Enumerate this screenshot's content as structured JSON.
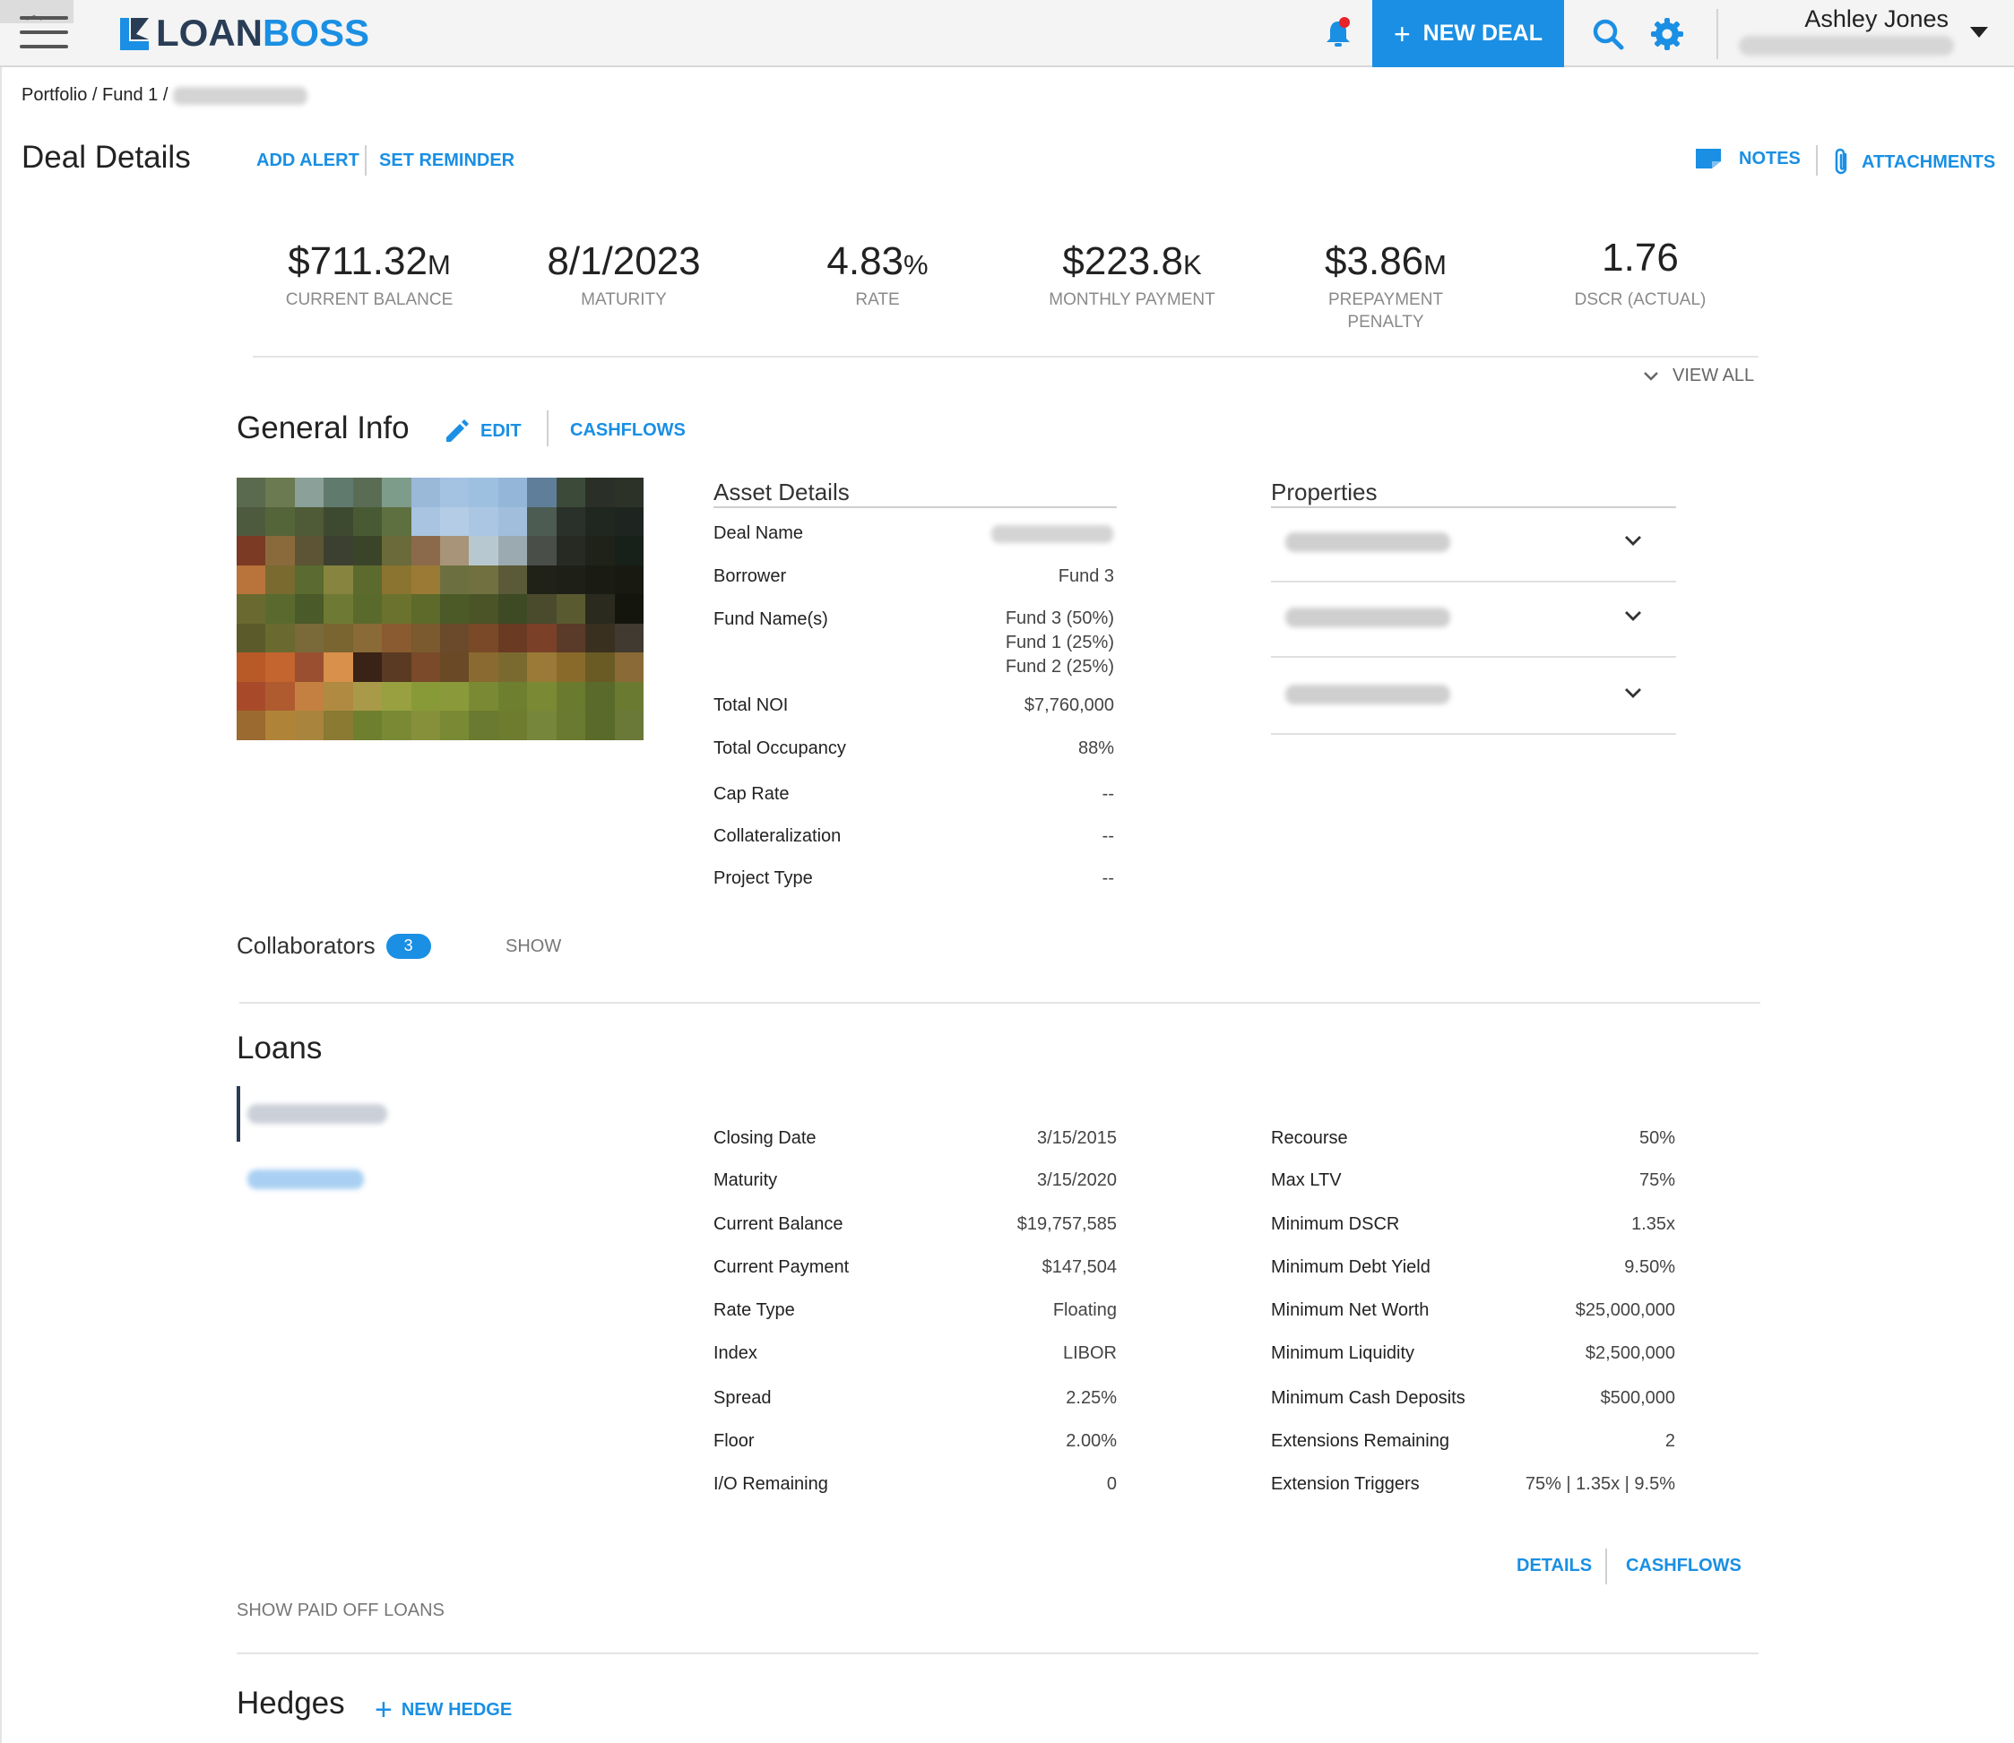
{
  "header": {
    "logo_text_a": "LOAN",
    "logo_text_b": "BOSS",
    "new_deal_label": "NEW DEAL",
    "user_name": "Ashley Jones",
    "brand_color": "#1a8fe3",
    "icons": [
      "menu-icon",
      "bell-icon",
      "search-icon",
      "gear-icon",
      "chevron-down-icon"
    ]
  },
  "breadcrumb": {
    "text": "Portfolio / Fund 1 /"
  },
  "page": {
    "title": "Deal Details",
    "add_alert": "ADD ALERT",
    "set_reminder": "SET REMINDER",
    "notes": "NOTES",
    "attachments": "ATTACHMENTS"
  },
  "stats": [
    {
      "value": "$711.32",
      "unit": "M",
      "label": "CURRENT BALANCE"
    },
    {
      "value": "8/1/2023",
      "unit": "",
      "label": "MATURITY"
    },
    {
      "value": "4.83",
      "unit": "%",
      "label": "RATE"
    },
    {
      "value": "$223.8",
      "unit": "K",
      "label": "MONTHLY PAYMENT"
    },
    {
      "value": "$3.86",
      "unit": "M",
      "label": "PREPAYMENT PENALTY"
    },
    {
      "value": "1.76",
      "unit": "",
      "label": "DSCR (ACTUAL)"
    }
  ],
  "view_all": "VIEW ALL",
  "general_info": {
    "title": "General Info",
    "edit": "EDIT",
    "cashflows": "CASHFLOWS",
    "asset_details_title": "Asset Details",
    "properties_title": "Properties",
    "asset_details": [
      {
        "label": "Deal Name",
        "value": ""
      },
      {
        "label": "Borrower",
        "value": "Fund 3"
      },
      {
        "label": "Fund Name(s)",
        "value": "Fund 3 (50%)\nFund 1 (25%)\nFund 2 (25%)"
      },
      {
        "label": "Total NOI",
        "value": "$7,760,000"
      },
      {
        "label": "Total Occupancy",
        "value": "88%"
      },
      {
        "label": "Cap Rate",
        "value": "--"
      },
      {
        "label": "Collateralization",
        "value": "--"
      },
      {
        "label": "Project Type",
        "value": "--"
      }
    ],
    "collaborators_label": "Collaborators",
    "collaborators_count": "3",
    "show": "SHOW"
  },
  "loans": {
    "title": "Loans",
    "left_terms": [
      {
        "label": "Closing Date",
        "value": "3/15/2015"
      },
      {
        "label": "Maturity",
        "value": "3/15/2020"
      },
      {
        "label": "Current Balance",
        "value": "$19,757,585"
      },
      {
        "label": "Current Payment",
        "value": "$147,504"
      },
      {
        "label": "Rate Type",
        "value": "Floating"
      },
      {
        "label": "Index",
        "value": "LIBOR"
      },
      {
        "label": "Spread",
        "value": "2.25%"
      },
      {
        "label": "Floor",
        "value": "2.00%"
      },
      {
        "label": "I/O Remaining",
        "value": "0"
      }
    ],
    "right_terms": [
      {
        "label": "Recourse",
        "value": "50%"
      },
      {
        "label": "Max LTV",
        "value": "75%"
      },
      {
        "label": "Minimum DSCR",
        "value": "1.35x"
      },
      {
        "label": "Minimum Debt Yield",
        "value": "9.50%"
      },
      {
        "label": "Minimum Net Worth",
        "value": "$25,000,000"
      },
      {
        "label": "Minimum Liquidity",
        "value": "$2,500,000"
      },
      {
        "label": "Minimum Cash Deposits",
        "value": "$500,000"
      },
      {
        "label": "Extensions Remaining",
        "value": "2"
      },
      {
        "label": "Extension Triggers",
        "value": "75% | 1.35x | 9.5%"
      }
    ],
    "details": "DETAILS",
    "cashflows": "CASHFLOWS",
    "show_paid_off": "SHOW PAID OFF LOANS"
  },
  "hedges": {
    "title": "Hedges",
    "new_hedge": "NEW HEDGE"
  }
}
